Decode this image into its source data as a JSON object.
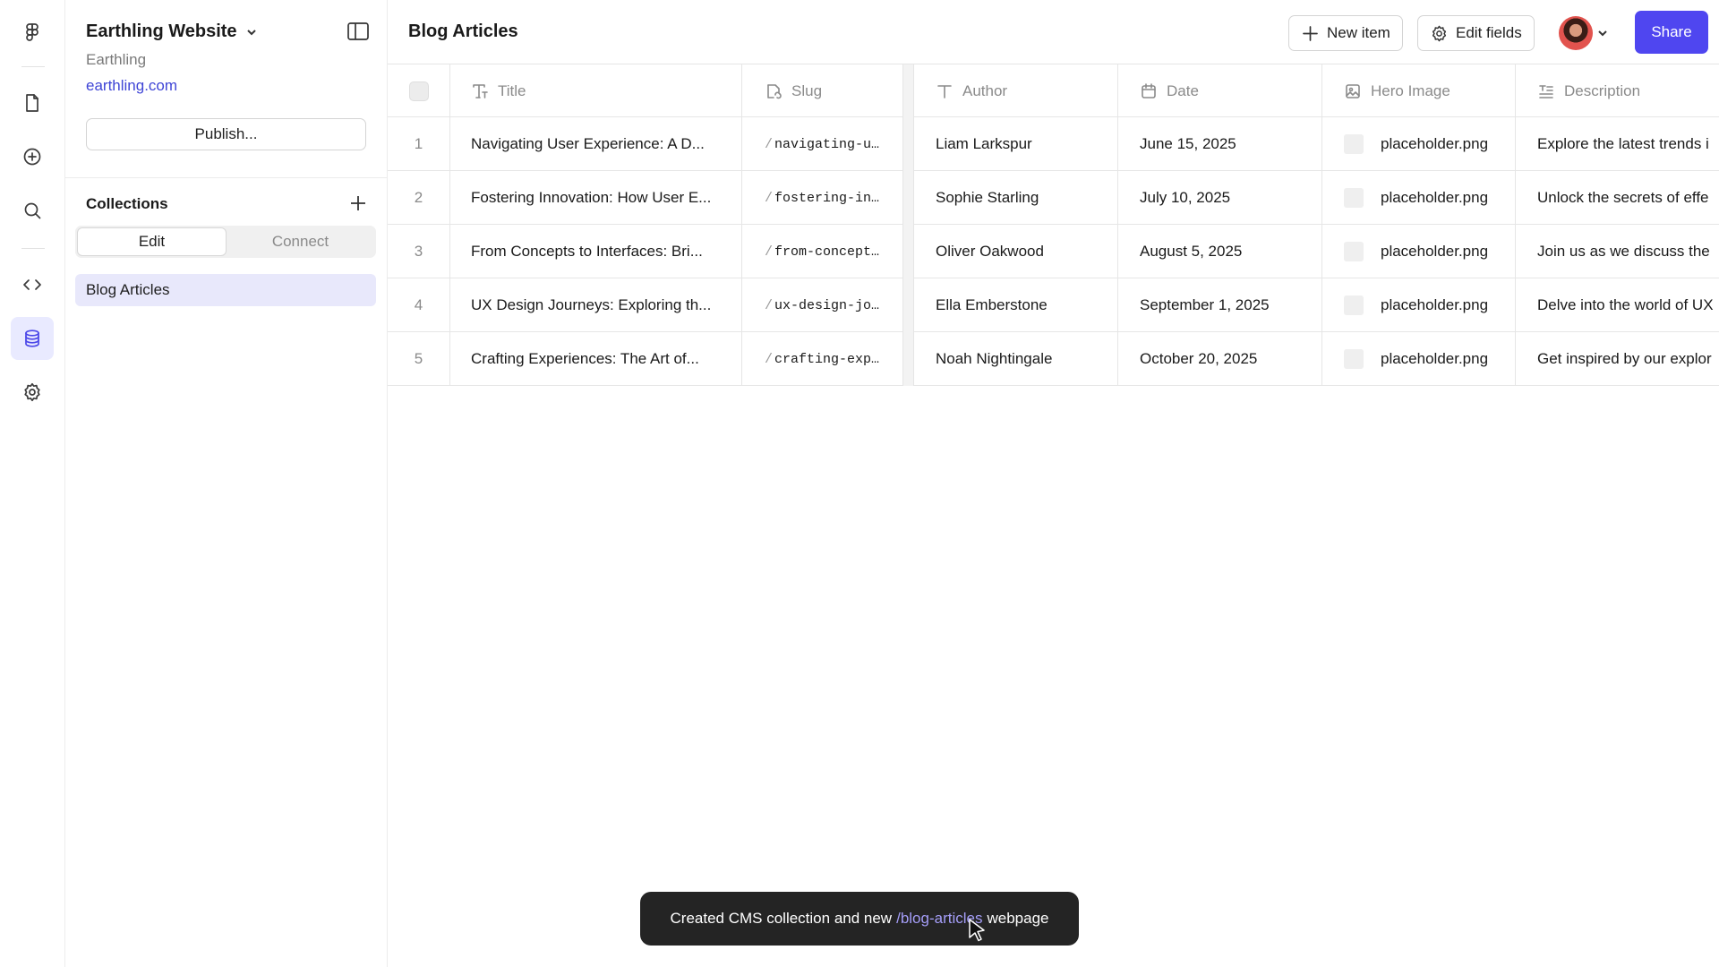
{
  "rail": {
    "icons": [
      "figma-logo-icon",
      "file-icon",
      "plus-circle-icon",
      "search-icon",
      "code-icon",
      "database-icon",
      "gear-icon"
    ]
  },
  "panel": {
    "site_title": "Earthling Website",
    "team_name": "Earthling",
    "site_link": "earthling.com",
    "publish_label": "Publish...",
    "collections_label": "Collections",
    "tabs": [
      {
        "label": "Edit",
        "active": true
      },
      {
        "label": "Connect",
        "active": false
      }
    ],
    "collections": [
      {
        "label": "Blog Articles",
        "selected": true
      }
    ]
  },
  "header": {
    "title": "Blog Articles",
    "new_item_label": "New item",
    "edit_fields_label": "Edit fields",
    "share_label": "Share"
  },
  "table": {
    "columns": [
      {
        "key": "title",
        "label": "Title",
        "icon": "title-field-icon"
      },
      {
        "key": "slug",
        "label": "Slug",
        "icon": "slug-field-icon"
      },
      {
        "key": "author",
        "label": "Author",
        "icon": "text-field-icon"
      },
      {
        "key": "date",
        "label": "Date",
        "icon": "calendar-icon"
      },
      {
        "key": "hero",
        "label": "Hero Image",
        "icon": "image-icon"
      },
      {
        "key": "description",
        "label": "Description",
        "icon": "paragraph-icon"
      }
    ],
    "rows": [
      {
        "num": "1",
        "title": "Navigating User Experience: A D...",
        "slug": "navigating-u…",
        "author": "Liam Larkspur",
        "date": "June 15, 2025",
        "hero": "placeholder.png",
        "description": "Explore the latest trends i"
      },
      {
        "num": "2",
        "title": "Fostering Innovation: How User E...",
        "slug": "fostering-in…",
        "author": "Sophie Starling",
        "date": "July 10, 2025",
        "hero": "placeholder.png",
        "description": "Unlock the secrets of effe"
      },
      {
        "num": "3",
        "title": "From Concepts to Interfaces: Bri...",
        "slug": "from-concept…",
        "author": "Oliver Oakwood",
        "date": "August 5, 2025",
        "hero": "placeholder.png",
        "description": "Join us as we discuss the"
      },
      {
        "num": "4",
        "title": "UX Design Journeys: Exploring th...",
        "slug": "ux-design-jo…",
        "author": "Ella Emberstone",
        "date": "September 1, 2025",
        "hero": "placeholder.png",
        "description": "Delve into the world of UX"
      },
      {
        "num": "5",
        "title": "Crafting Experiences: The Art of...",
        "slug": "crafting-exp…",
        "author": "Noah Nightingale",
        "date": "October 20, 2025",
        "hero": "placeholder.png",
        "description": "Get inspired by our explor"
      }
    ]
  },
  "toast": {
    "text_before": "Created CMS collection and new",
    "link": "/blog-articles",
    "text_after": "webpage"
  },
  "colors": {
    "accent": "#4f46f0",
    "link": "#3f45d6",
    "selected_bg": "#e8e8fb",
    "toast_bg": "#242424",
    "toast_link": "#a49df7"
  }
}
